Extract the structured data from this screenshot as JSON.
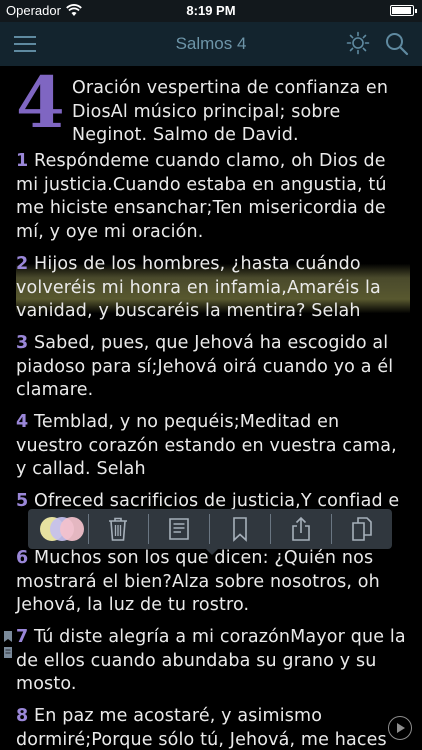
{
  "status_bar": {
    "carrier": "Operador",
    "time": "8:19 PM",
    "battery_level": 0.95
  },
  "nav": {
    "title": "Salmos 4",
    "icons": [
      "menu-icon",
      "brightness-icon",
      "search-icon"
    ]
  },
  "chapter": {
    "number": "4",
    "heading": "Oración vespertina de confianza en DiosAl músico principal; sobre Neginot. Salmo de David."
  },
  "verses": [
    {
      "num": "1",
      "text": " Respóndeme cuando clamo, oh Dios de mi justicia.Cuando estaba en angustia, tú me hiciste ensanchar;Ten misericordia de mí, y oye mi oración.",
      "highlighted": false
    },
    {
      "num": "2",
      "text": " Hijos de los hombres, ¿hasta cuándo volveréis mi honra en infamia,Amaréis la vanidad, y buscaréis la mentira? Selah",
      "highlighted": true
    },
    {
      "num": "3",
      "text": " Sabed, pues, que Jehová ha escogido al piadoso para sí;Jehová oirá cuando yo a él clamare.",
      "highlighted": false
    },
    {
      "num": "4",
      "text": " Temblad, y no pequéis;Meditad en vuestro corazón estando en vuestra cama, y callad. Selah",
      "highlighted": false
    },
    {
      "num": "5",
      "text": " Ofreced sacrificios de justicia,Y confiad e",
      "highlighted": false
    },
    {
      "num": "6",
      "text": " Muchos son los que dicen: ¿Quién nos mostrará el bien?Alza sobre nosotros, oh Jehová, la luz de tu rostro.",
      "highlighted": false
    },
    {
      "num": "7",
      "text": " Tú diste alegría a mi corazónMayor que la de ellos cuando abundaba su grano y su mosto.",
      "highlighted": false
    },
    {
      "num": "8",
      "text": " En paz me acostaré, y asimismo dormiré;Porque sólo tú, Jehová, me haces",
      "highlighted": false
    }
  ],
  "toolbar": {
    "highlight_colors": [
      "#f6f0a8",
      "#c6c0ee",
      "#f4c2cc"
    ],
    "icons": [
      "highlight-colors-icon",
      "trash-icon",
      "note-icon",
      "bookmark-icon",
      "share-icon",
      "copy-icon"
    ]
  },
  "colors": {
    "nav_background": "#13242e",
    "accent": "#7f66c2",
    "verse_number": "#9a87d8",
    "highlight": "#58582f"
  }
}
